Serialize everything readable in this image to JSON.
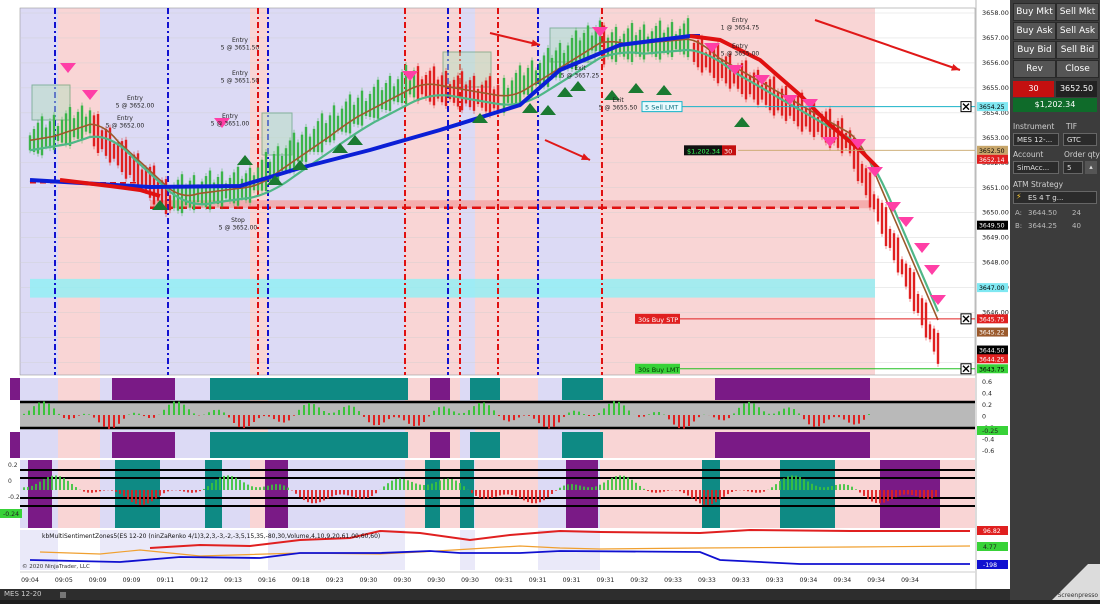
{
  "time_axis": [
    "09:04",
    "09:05",
    "09:09",
    "09:09",
    "09:11",
    "09:12",
    "09:13",
    "09:16",
    "09:18",
    "09:23",
    "09:30",
    "09:30",
    "09:30",
    "09:30",
    "09:31",
    "09:31",
    "09:31",
    "09:31",
    "09:32",
    "09:33",
    "09:33",
    "09:33",
    "09:33",
    "09:34",
    "09:34",
    "09:34",
    "09:34"
  ],
  "price_axis": [
    "3658.00",
    "3657.00",
    "3656.00",
    "3655.00",
    "3654.00",
    "3653.00",
    "3652.00",
    "3651.00",
    "3650.00",
    "3649.00",
    "3648.00",
    "3647.00",
    "3646.00"
  ],
  "price_tags": {
    "sell_lmt": "3654.25",
    "p1": "3652.50",
    "p2": "3652.14",
    "p3": "3649.50",
    "p4": "3647.00",
    "buy_stp": "3645.75",
    "p5": "3645.22",
    "last": "3644.50",
    "p6": "3644.25",
    "buy_lmt": "3643.75"
  },
  "order_labels": {
    "sell_lmt": "5  Sell LMT",
    "buy_stp": "30s  Buy STP",
    "buy_lmt": "30s  Buy LMT",
    "pnl": "$1,202.34",
    "pnl_qty": "30"
  },
  "trade_labels": [
    "Entry\n5 @ 3652.00",
    "Entry\n5 @ 3652.00",
    "Entry\n5 @ 3651.50",
    "Entry\n5 @ 3651.50",
    "Entry\n5 @ 3651.00",
    "Exit\n5 @ 3655.50",
    "Exit\n5 @ 3657.25",
    "Entry\n1 @ 3654.75",
    "Entry\n5 @ 3655.00",
    "Stop\n5 @ 3652.00"
  ],
  "osc1_axis": [
    "0.6",
    "0.4",
    "0.2",
    "0",
    "-0.2",
    "-0.4",
    "-0.6"
  ],
  "osc1_tag": "-0.25",
  "osc2_axis": [
    "0.2",
    "0",
    "-0.2",
    "-0.4"
  ],
  "osc2_tag": "-0.24",
  "osc3_tags": {
    "top": "96.82",
    "mid": "4.77",
    "bot": "-198"
  },
  "indicator_label": "kbMultiSentimentZones5(ES 12-20 (ninZaRenko 4/1)3,2,3,-3,-2,-3,5,15,35,-80,30,Volume,4,10,9,20,61.00,60,60)",
  "copyright": "© 2020 NinjaTrader, LLC",
  "bottom_tab": "MES 12-20",
  "watermark": "Screenpresso",
  "panel": {
    "buttons": [
      "Buy Mkt",
      "Sell Mkt",
      "Buy Ask",
      "Sell Ask",
      "Buy Bid",
      "Sell Bid",
      "Rev",
      "Close"
    ],
    "qty": "30",
    "price": "3652.50",
    "pnl": "$1,202.34",
    "instrument_label": "Instrument",
    "tif_label": "TIF",
    "instrument": "MES 12-...",
    "tif": "GTC",
    "account_label": "Account",
    "order_qty_label": "Order qty",
    "account": "SimAcc...",
    "order_qty": "5",
    "atm_label": "ATM Strategy",
    "atm": "ES 4 T g...",
    "ask_label": "A:",
    "ask_price": "3644.50",
    "ask_size": "24",
    "bid_label": "B:",
    "bid_price": "3644.25",
    "bid_size": "40"
  },
  "colors": {
    "up": "#3cb44b",
    "down": "#e02020",
    "ma_blue": "#0b1fd6",
    "pink_zone": "#f9d5d5",
    "lavender_zone": "#dcdaf5",
    "teal": "#0e8a84",
    "purple": "#7a1a86"
  }
}
